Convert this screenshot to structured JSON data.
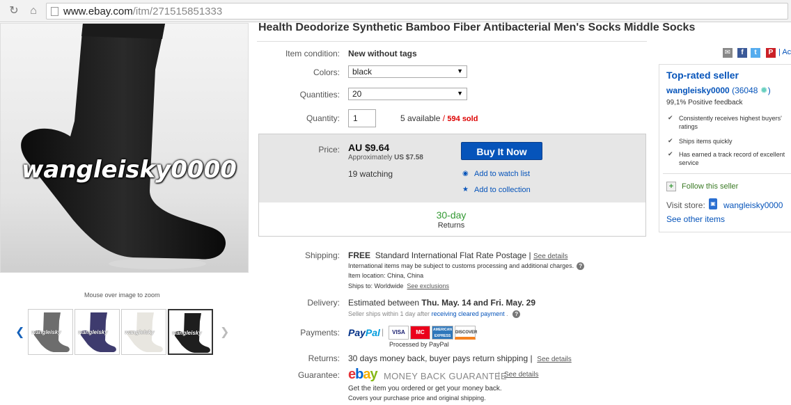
{
  "browser": {
    "url_host": "www.ebay.com",
    "url_path": "/itm/271515851333"
  },
  "gallery": {
    "watermark": "wangleisky0000",
    "zoom_hint": "Mouse over image to zoom",
    "thumb_watermark": "wangleisky",
    "thumbnails": [
      {
        "color": "#6d6d6d"
      },
      {
        "color": "#3e3b6e"
      },
      {
        "color": "#e8e6e0"
      },
      {
        "color": "#1e1e1e"
      }
    ],
    "selected_thumbnail": 4
  },
  "item": {
    "title": "Health Deodorize Synthetic Bamboo Fiber Antibacterial Men's Socks Middle Socks",
    "condition_label": "Item condition:",
    "condition_value": "New without tags",
    "colors_label": "Colors:",
    "colors_value": "black",
    "quantities_label": "Quantities:",
    "quantities_value": "20",
    "quantity_label": "Quantity:",
    "quantity_value": "1",
    "available": "5 available",
    "sold_sep": "/",
    "sold": "594 sold"
  },
  "buybox": {
    "price_label": "Price:",
    "price": "AU $9.64",
    "approx_label": "Approximately",
    "approx_value": "US $7.58",
    "watching": "19 watching",
    "buy_now": "Buy It Now",
    "add_watch": "Add to watch list",
    "add_collection": "Add to collection",
    "returns_days": "30-day",
    "returns_label": "Returns"
  },
  "shipping": {
    "label": "Shipping:",
    "free": "FREE",
    "service": "Standard International Flat Rate Postage",
    "see_details": "See details",
    "note": "International items may be subject to customs processing and additional charges.",
    "location_label": "Item location:",
    "location_value": "China, China",
    "ships_to_label": "Ships to:",
    "ships_to_value": "Worldwide",
    "see_exclusions": "See exclusions"
  },
  "delivery": {
    "label": "Delivery:",
    "estimated_prefix": "Estimated between",
    "estimated_range": "Thu. May. 14 and Fri. May. 29",
    "ships_note_prefix": "Seller ships within 1 day after",
    "ships_note_link": "receiving cleared payment"
  },
  "payments": {
    "label": "Payments:",
    "paypal_1": "Pay",
    "paypal_2": "Pal",
    "processed_by": "Processed by PayPal",
    "cards": [
      "VISA",
      "MC",
      "AMERICAN EXPRESS",
      "DISCOVER"
    ]
  },
  "returns": {
    "label": "Returns:",
    "text": "30 days money back, buyer pays return shipping",
    "see_details": "See details"
  },
  "guarantee": {
    "label": "Guarantee:",
    "logo_letters": [
      "e",
      "b",
      "a",
      "y"
    ],
    "logo_colors": [
      "#e53238",
      "#0064d2",
      "#f5af02",
      "#86b817"
    ],
    "title": "MONEY BACK GUARANTEE",
    "see_details": "See details",
    "line1": "Get the item you ordered or get your money back.",
    "line2": "Covers your purchase price and original shipping."
  },
  "seller": {
    "badge_title": "Top-rated seller",
    "name": "wangleisky0000",
    "score": "(36048",
    "feedback": "99,1% Positive feedback",
    "points": [
      "Consistently receives highest buyers' ratings",
      "Ships items quickly",
      "Has earned a track record of excellent service"
    ],
    "follow": "Follow this seller",
    "visit_label": "Visit store:",
    "store_name": "wangleisky0000",
    "other_items": "See other items",
    "share_cut": "Ac"
  }
}
